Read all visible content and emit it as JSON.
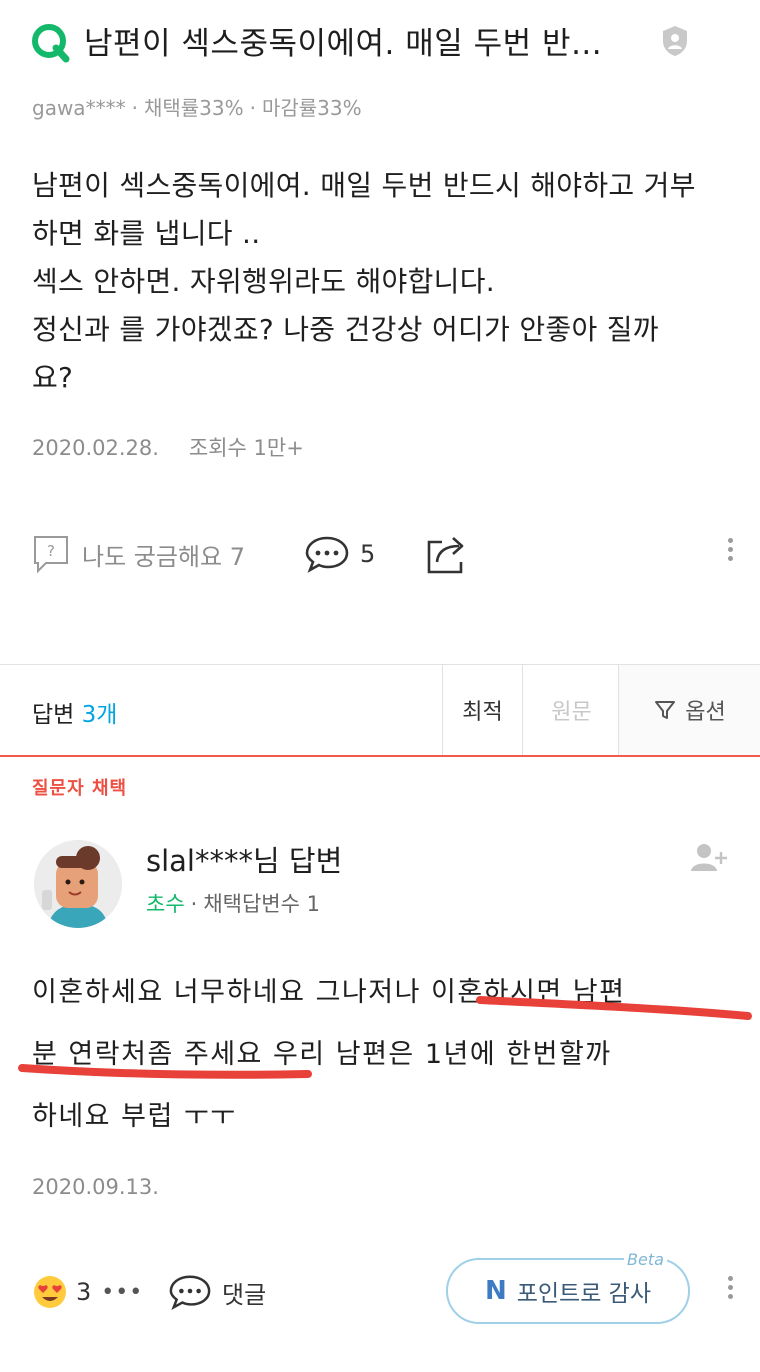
{
  "question": {
    "title": "남편이 섹스중독이에여. 매일 두번 반...",
    "author": "gawa****",
    "adopt_rate": "채택률33%",
    "close_rate": "마감률33%",
    "body_lines": [
      "남편이 섹스중독이에여. 매일 두번 반드시 해야하고 거부",
      "하면 화를 냅니다 ..",
      "섹스 안하면. 자위행위라도 해야합니다.",
      "정신과 를 가야겠죠? 나중 건강상 어디가 안좋아 질까",
      "요?"
    ],
    "date": "2020.02.28.",
    "views": "조회수 1만+",
    "curious_label": "나도 궁금해요 7",
    "comment_count": "5"
  },
  "answers_bar": {
    "label": "답변",
    "count": "3개",
    "sort_latest": "최적",
    "sort_original": "원문",
    "options": "옵션"
  },
  "answer": {
    "chosen_label": "질문자 채택",
    "author": "slal****님 답변",
    "rank": "초수",
    "adopted_count": "채택답변수 1",
    "body_lines": [
      "이혼하세요  너무하네요  그나저나  이혼하시면  남편",
      "분  연락처좀  주세요  우리  남편은  1년에  한번할까",
      "하네요  부럽  ㅜㅜ"
    ],
    "date": "2020.09.13.",
    "emoji_count": "3",
    "more": "•••",
    "reply_label": "댓글",
    "thanks_label": "포인트로 감사",
    "thanks_mark": "N",
    "beta": "Beta"
  },
  "colors": {
    "brand_green": "#14b86a",
    "accent_blue": "#03a5e2",
    "accent_red": "#ee4f43"
  },
  "icons": [
    "q-logo-icon",
    "shield-icon",
    "question-box-icon",
    "speech-bubble-icon",
    "share-icon",
    "kebab-icon",
    "filter-icon",
    "add-user-icon",
    "heart-eyes-emoji-icon"
  ]
}
